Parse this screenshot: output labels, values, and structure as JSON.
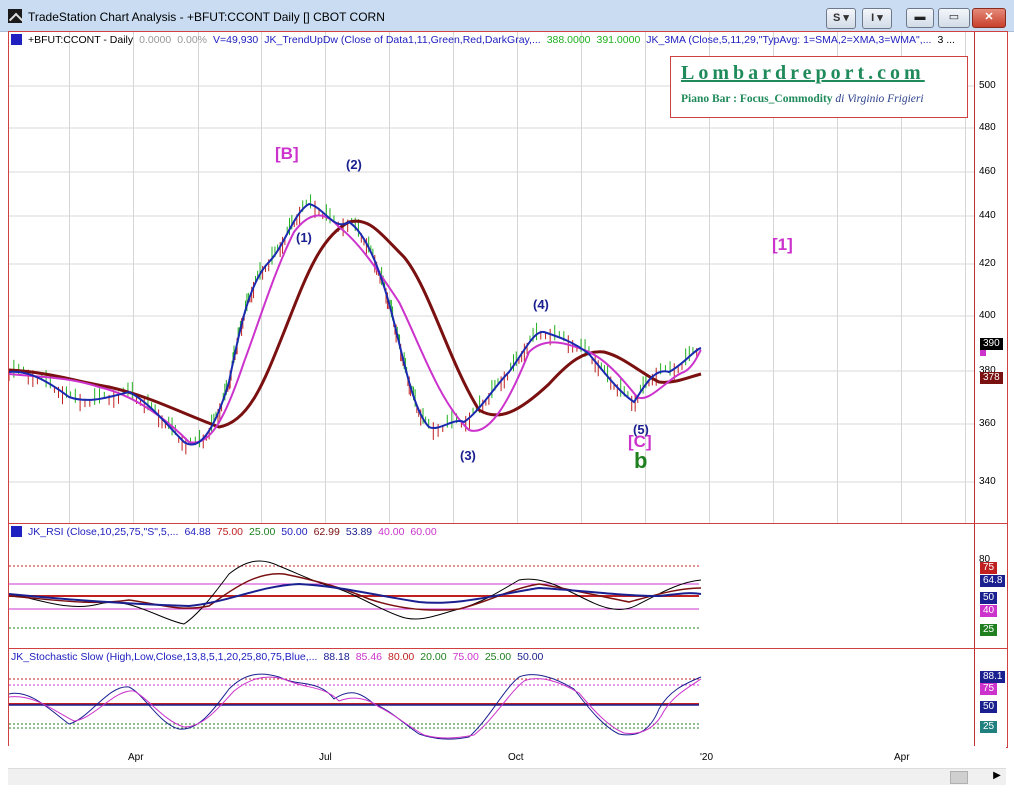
{
  "window": {
    "title": "TradeStation Chart Analysis - +BFUT:CCONT Daily [] CBOT CORN",
    "btn_s": "S ▾",
    "btn_i": "I ▾",
    "min": "▬",
    "max": "▭",
    "close": "✕"
  },
  "price_pane": {
    "symbol": "+BFUT:CCONT - Daily",
    "v1": "0.0000",
    "v2": "0.00%",
    "volume": "V=49,930",
    "trend_study": "JK_TrendUpDw (Close of Data1,11,Green,Red,DarkGray,...",
    "trend_v1": "388.0000",
    "trend_v2": "391.0000",
    "ma_study": "JK_3MA (Close,5,11,29,\"TypAvg: 1=SMA,2=XMA,3=WMA\",...",
    "ma_v": "3 ...",
    "y_ticks": [
      "500",
      "480",
      "460",
      "440",
      "420",
      "400",
      "380",
      "360",
      "340"
    ],
    "last_label": "390",
    "ma_label": "378",
    "waves": [
      "[B]",
      "(2)",
      "(1)",
      "(4)",
      "(3)",
      "(5)",
      "[C]",
      "b",
      "[1]"
    ]
  },
  "logo": {
    "title": "Lombardreport.com",
    "subtitle": "Piano Bar : Focus_Commodity",
    "author": "di Virginio Frigieri"
  },
  "rsi_pane": {
    "study": "JK_RSI (Close,10,25,75,\"S\",5,...",
    "values": [
      "64.88",
      "75.00",
      "25.00",
      "50.00",
      "62.99",
      "53.89",
      "40.00",
      "60.00"
    ],
    "y_ticks": [
      "80"
    ],
    "labels": [
      "75",
      "64.8",
      "50",
      "40",
      "25"
    ]
  },
  "stoch_pane": {
    "study": "JK_Stochastic Slow (High,Low,Close,13,8,5,1,20,25,80,75,Blue,...",
    "values": [
      "88.18",
      "85.46",
      "80.00",
      "20.00",
      "75.00",
      "25.00",
      "50.00"
    ],
    "labels": [
      "88.1",
      "75",
      "50",
      "25"
    ]
  },
  "x_axis": [
    "Apr",
    "Jul",
    "Oct",
    "'20",
    "Apr"
  ],
  "colors": {
    "price_up": "#20b020",
    "price_dn": "#c02020",
    "fast_ma": "#1a2ab0",
    "mid_ma": "#cc33cc",
    "slow_ma": "#7a1010",
    "wave_mag": "#cc33cc",
    "wave_blue": "#1a2090",
    "wave_green": "#208020"
  }
}
